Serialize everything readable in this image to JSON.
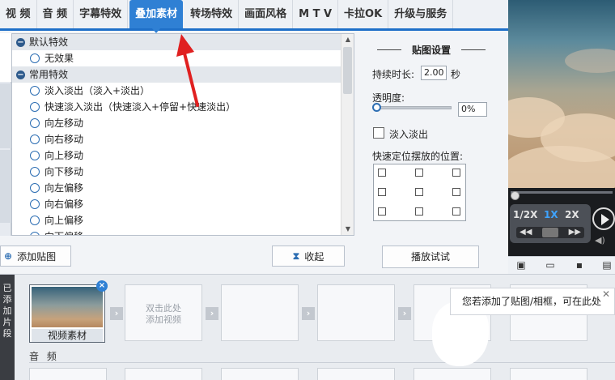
{
  "menu": {
    "items": [
      "视 频",
      "音 频",
      "字幕特效",
      "叠加素材",
      "转场特效",
      "画面风格",
      "M T V",
      "卡拉OK",
      "升级与服务"
    ],
    "active_index": 3
  },
  "effects": {
    "groups": [
      {
        "label": "默认特效",
        "items": [
          "无效果"
        ]
      },
      {
        "label": "常用特效",
        "items": [
          "淡入淡出（淡入+淡出）",
          "快速淡入淡出（快速淡入+停留+快速淡出）",
          "向左移动",
          "向右移动",
          "向上移动",
          "向下移动",
          "向左偏移",
          "向右偏移",
          "向上偏移",
          "向下偏移"
        ]
      }
    ]
  },
  "buttons": {
    "add_sticker": "添加贴图",
    "collapse": "收起",
    "play_test": "播放试试"
  },
  "sticker_settings": {
    "title": "贴图设置",
    "duration_label": "持续时长:",
    "duration_value": "2.00",
    "duration_unit": "秒",
    "opacity_label": "透明度:",
    "opacity_value": "0%",
    "opacity_level": 0,
    "fade_label": "淡入淡出",
    "fade_checked": false,
    "position_label": "快速定位摆放的位置:"
  },
  "player": {
    "speeds": [
      "1/2X",
      "1X",
      "2X"
    ],
    "active_speed": "1X"
  },
  "timeline": {
    "side_label": "已添加片段",
    "video_clip_name": "视频素材",
    "add_video_hint": "双击此处\n添加视频",
    "audio_label": "音 频"
  },
  "tooltip": {
    "text": "您若添加了贴图/相框，可在此处"
  },
  "colors": {
    "accent": "#2f80d4",
    "annotation_arrow": "#e02020"
  }
}
